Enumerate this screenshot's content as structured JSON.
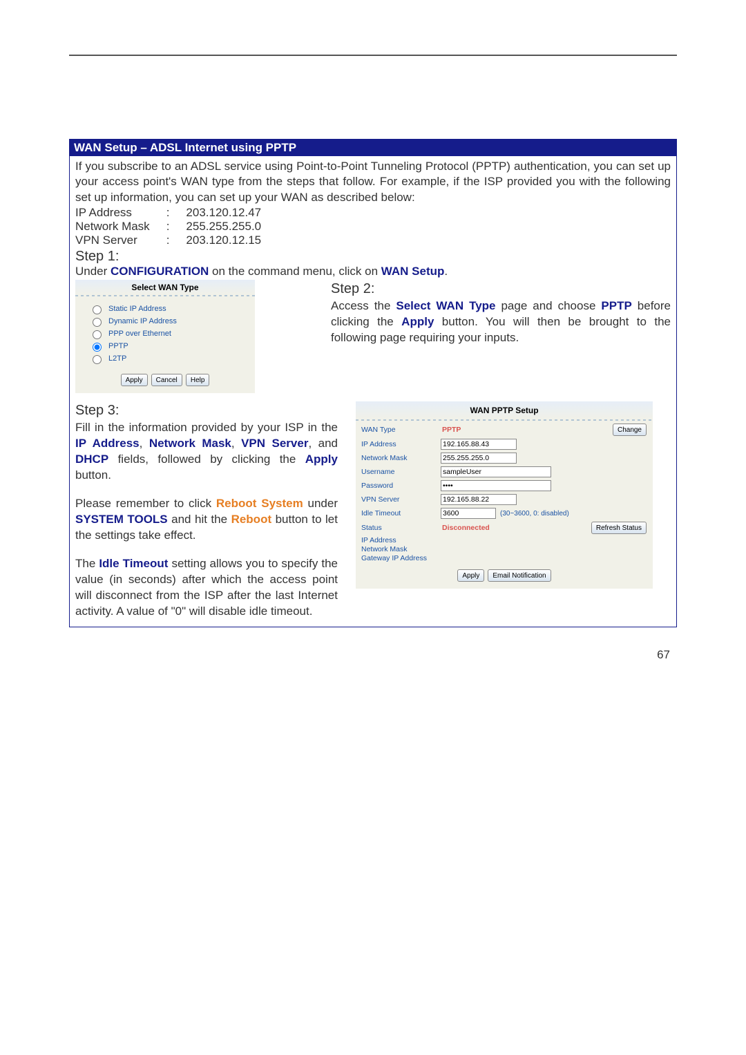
{
  "banner": "WAN Setup – ADSL Internet using PPTP",
  "intro": "If you subscribe to an ADSL service using Point-to-Point Tunneling Protocol (PPTP) authentication, you can set up your access point's WAN type from the steps that follow. For example, if the ISP provided you with the following set up information, you can set up your WAN as described below:",
  "kv": {
    "ip_label": "IP Address",
    "ip_val": "203.120.12.47",
    "nm_label": "Network Mask",
    "nm_val": "255.255.255.0",
    "vpn_label": "VPN Server",
    "vpn_val": "203.120.12.15"
  },
  "step1_head": "Step 1:",
  "step1_pre": "Under ",
  "step1_conf": "CONFIGURATION",
  "step1_mid": " on the command menu, click on ",
  "step1_link": "WAN Setup",
  "step1_suf": ".",
  "wan_select": {
    "title": "Select WAN Type",
    "options": [
      "Static IP Address",
      "Dynamic IP Address",
      "PPP over Ethernet",
      "PPTP",
      "L2TP"
    ],
    "btn_apply": "Apply",
    "btn_cancel": "Cancel",
    "btn_help": "Help"
  },
  "step2_head": "Step 2:",
  "step2_a": "Access the ",
  "step2_b": "Select WAN Type",
  "step2_c": " page and choose ",
  "step2_d": "PPTP",
  "step2_e": " before clicking the ",
  "step2_f": "Apply",
  "step2_g": " button.  You will then be brought to the following page requiring your inputs.",
  "step3_head": "Step 3:",
  "step3_p1_a": "Fill in the information provided by your ISP in the ",
  "step3_p1_b": "IP Address",
  "step3_p1_c": ", ",
  "step3_p1_d": "Network Mask",
  "step3_p1_e": ", ",
  "step3_p1_f": "VPN Server",
  "step3_p1_g": ", and ",
  "step3_p1_h": "DHCP",
  "step3_p1_i": " fields, followed by clicking the ",
  "step3_p1_j": "Apply",
  "step3_p1_k": " button.",
  "step3_p2_a": "Please remember to click ",
  "step3_p2_b": "Reboot System",
  "step3_p2_c": " under ",
  "step3_p2_d": "SYSTEM TOOLS",
  "step3_p2_e": " and hit the ",
  "step3_p2_f": "Reboot",
  "step3_p2_g": " button to let the settings take effect.",
  "step3_p3_a": "The ",
  "step3_p3_b": "Idle Timeout",
  "step3_p3_c": " setting allows you to specify the value (in seconds) after which the access point will disconnect from the ISP after the last Internet activity. A value of \"0\" will disable idle timeout.",
  "pptp": {
    "title": "WAN PPTP Setup",
    "l_wan_type": "WAN Type",
    "v_wan_type": "PPTP",
    "btn_change": "Change",
    "l_ip": "IP Address",
    "v_ip": "192.165.88.43",
    "l_nm": "Network Mask",
    "v_nm": "255.255.255.0",
    "l_user": "Username",
    "v_user": "sampleUser",
    "l_pass": "Password",
    "v_pass": "••••",
    "l_vpn": "VPN Server",
    "v_vpn": "192.165.88.22",
    "l_idle": "Idle Timeout",
    "v_idle": "3600",
    "idle_hint": "(30~3600, 0: disabled)",
    "l_status": "Status",
    "v_status": "Disconnected",
    "btn_refresh": "Refresh Status",
    "ext1": "IP Address",
    "ext2": "Network Mask",
    "ext3": "Gateway IP Address",
    "btn_apply": "Apply",
    "btn_email": "Email Notification"
  },
  "page_num": "67"
}
